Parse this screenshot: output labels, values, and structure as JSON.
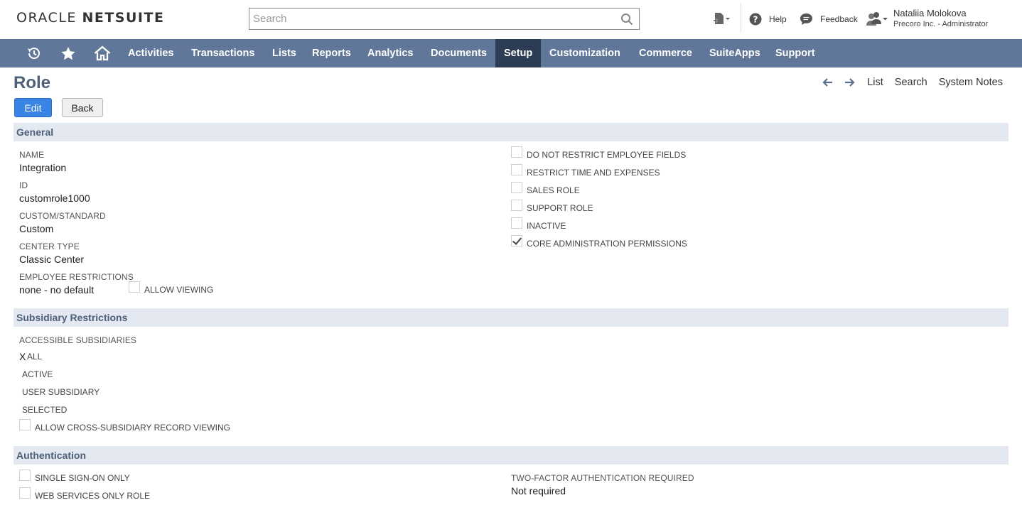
{
  "header": {
    "logo_brand": "ORACLE",
    "logo_product": "NETSUITE",
    "search_placeholder": "Search",
    "help_label": "Help",
    "feedback_label": "Feedback",
    "user_name": "Nataliia Molokova",
    "user_role": "Precoro Inc. - Administrator"
  },
  "nav": {
    "items": [
      "Activities",
      "Transactions",
      "Lists",
      "Reports",
      "Analytics",
      "Documents",
      "Setup",
      "Customization",
      "Commerce",
      "SuiteApps",
      "Support"
    ],
    "active": "Setup"
  },
  "page": {
    "title": "Role",
    "edit_label": "Edit",
    "back_label": "Back",
    "links": [
      "List",
      "Search",
      "System Notes"
    ]
  },
  "general": {
    "section_title": "General",
    "fields": [
      {
        "label": "NAME",
        "value": "Integration"
      },
      {
        "label": "ID",
        "value": "customrole1000"
      },
      {
        "label": "CUSTOM/STANDARD",
        "value": "Custom"
      },
      {
        "label": "CENTER TYPE",
        "value": "Classic Center"
      },
      {
        "label": "EMPLOYEE RESTRICTIONS",
        "value": "none - no default"
      }
    ],
    "allow_viewing": {
      "label": "ALLOW VIEWING",
      "checked": false
    },
    "checkboxes": [
      {
        "label": "DO NOT RESTRICT EMPLOYEE FIELDS",
        "checked": false
      },
      {
        "label": "RESTRICT TIME AND EXPENSES",
        "checked": false
      },
      {
        "label": "SALES ROLE",
        "checked": false
      },
      {
        "label": "SUPPORT ROLE",
        "checked": false
      },
      {
        "label": "INACTIVE",
        "checked": false
      },
      {
        "label": "CORE ADMINISTRATION PERMISSIONS",
        "checked": true
      }
    ]
  },
  "subsidiary": {
    "section_title": "Subsidiary Restrictions",
    "label": "ACCESSIBLE SUBSIDIARIES",
    "selected_mark": "X",
    "options": [
      "ALL",
      "ACTIVE",
      "USER SUBSIDIARY",
      "SELECTED"
    ],
    "selected": "ALL",
    "cross": {
      "label": "ALLOW CROSS-SUBSIDIARY RECORD VIEWING",
      "checked": false
    }
  },
  "authentication": {
    "section_title": "Authentication",
    "checkboxes": [
      {
        "label": "SINGLE SIGN-ON ONLY",
        "checked": false
      },
      {
        "label": "WEB SERVICES ONLY ROLE",
        "checked": false
      }
    ],
    "two_factor": {
      "label": "TWO-FACTOR AUTHENTICATION REQUIRED",
      "value": "Not required"
    }
  },
  "colors": {
    "nav_bg": "#607799",
    "nav_active": "#2c3c55",
    "section_bg": "#e3e8f1",
    "title": "#4d5f79",
    "edit_button": "#3a84e6"
  }
}
